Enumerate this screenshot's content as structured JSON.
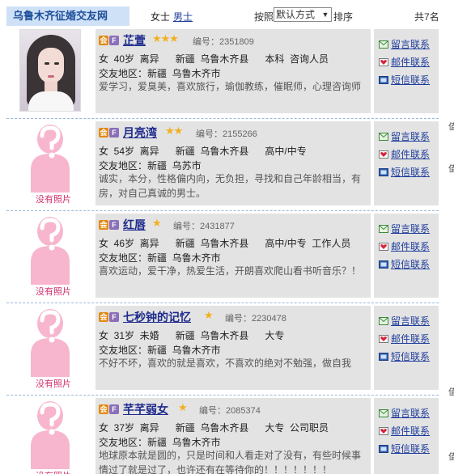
{
  "header": {
    "site_title": "乌鲁木齐征婚交友网",
    "gender_female": "女士",
    "gender_male": "男士",
    "sort_label": "按照",
    "sort_selected": "默认方式",
    "sort_suffix": "排序",
    "total": "共7名"
  },
  "actions": {
    "message": "留言联系",
    "email": "邮件联系",
    "sms": "短信联系"
  },
  "no_photo_label": "没有照片",
  "id_prefix": "编号：",
  "region_prefix": "交友地区：",
  "badge_labels": [
    "会",
    "F"
  ],
  "edge_glyphs": [
    "值",
    "值",
    "值",
    "值"
  ],
  "icons": {
    "message": "envelope-icon",
    "email": "heart-mail-icon",
    "sms": "phone-screen-icon",
    "stars": "star-icon",
    "no_photo": "silhouette-question-icon"
  },
  "colors": {
    "title_bg": "#cfe1f7",
    "title_text": "#1d4f9a",
    "card_bg": "#e3e3e3",
    "name_link": "#1e2a8c",
    "no_photo_pink": "#f7b6ce"
  },
  "members": [
    {
      "name": "芷萱",
      "stars": "★★★",
      "rating": 3,
      "id": "2351809",
      "basic": "女  40岁  离异      新疆  乌鲁木齐县      本科  咨询人员",
      "region": "新疆  乌鲁木齐市",
      "desc": "爱学习，爱臭美，喜欢旅行，瑜伽教练，催眠师，心理咨询师",
      "has_photo": true
    },
    {
      "name": "月亮湾",
      "stars": "★★",
      "rating": 2,
      "id": "2155266",
      "basic": "女  54岁  离异      新疆  乌鲁木齐县      高中/中专",
      "region": "新疆  乌苏市",
      "desc": "诚实，本分，性格偏内向，无负担，寻找和自己年龄相当，有房，对自己真诚的男士。",
      "has_photo": false
    },
    {
      "name": "红唇",
      "stars": "★",
      "rating": 1,
      "id": "2431877",
      "basic": "女  46岁  离异      新疆  乌鲁木齐县      高中/中专  工作人员",
      "region": "新疆  乌鲁木齐市",
      "desc": "喜欢运动，爱干净，热爱生活，开朗喜欢爬山看书听音乐？！",
      "has_photo": false
    },
    {
      "name": "七秒钟的记忆",
      "stars": "★",
      "rating": 1,
      "id": "2230478",
      "basic": "女  31岁  未婚      新疆  乌鲁木齐县      大专",
      "region": "新疆  乌鲁木齐市",
      "desc": "不好不坏，喜欢的就是喜欢，不喜欢的绝对不勉强，做自我",
      "has_photo": false
    },
    {
      "name": "芊芊弱女",
      "stars": "★",
      "rating": 1,
      "id": "2085374",
      "basic": "女  37岁  离异      新疆  乌鲁木齐县      大专  公司职员",
      "region": "新疆  乌鲁木齐市",
      "desc": "地球原本就是圆的，只是时间和人看走对了没有，有些时候事情过了就是过了，也许还有在等待你的！！！！！！！",
      "has_photo": false
    }
  ]
}
